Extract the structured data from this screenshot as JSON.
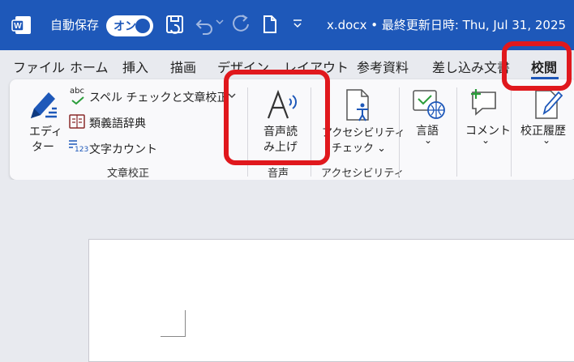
{
  "titlebar": {
    "autosave_label": "自動保存",
    "autosave_toggle": "オン",
    "filename": "x.docx • 最終更新日時: Thu, Jul 31, 2025"
  },
  "tabs": [
    "ファイル",
    "ホーム",
    "挿入",
    "描画",
    "デザイン",
    "レイアウト",
    "参考資料",
    "差し込み文書",
    "校閲"
  ],
  "active_tab": "校閲",
  "ribbon": {
    "editor": {
      "line1": "エディ",
      "line2": "ター"
    },
    "spelling": {
      "icon_text": "abc",
      "label": "スペル チェックと文章校正"
    },
    "thesaurus": "類義語辞典",
    "word_count": {
      "icon_text": "123",
      "label": "文字カウント"
    },
    "group_proofing": "文章校正",
    "read_aloud": {
      "line1": "音声読",
      "line2": "み上げ"
    },
    "group_speech": "音声",
    "accessibility": {
      "line1": "アクセシビリティ",
      "line2": "チェック ⌄"
    },
    "group_accessibility": "アクセシビリティ",
    "language": {
      "label": "言語",
      "caret": "⌄"
    },
    "comments": {
      "label": "コメント",
      "caret": "⌄"
    },
    "track_changes": {
      "label": "校正履歴",
      "caret": "⌄"
    }
  },
  "colors": {
    "titlebar": "#1e58b9",
    "highlight": "#e0181d",
    "ribbon": "#f9f9fb"
  }
}
